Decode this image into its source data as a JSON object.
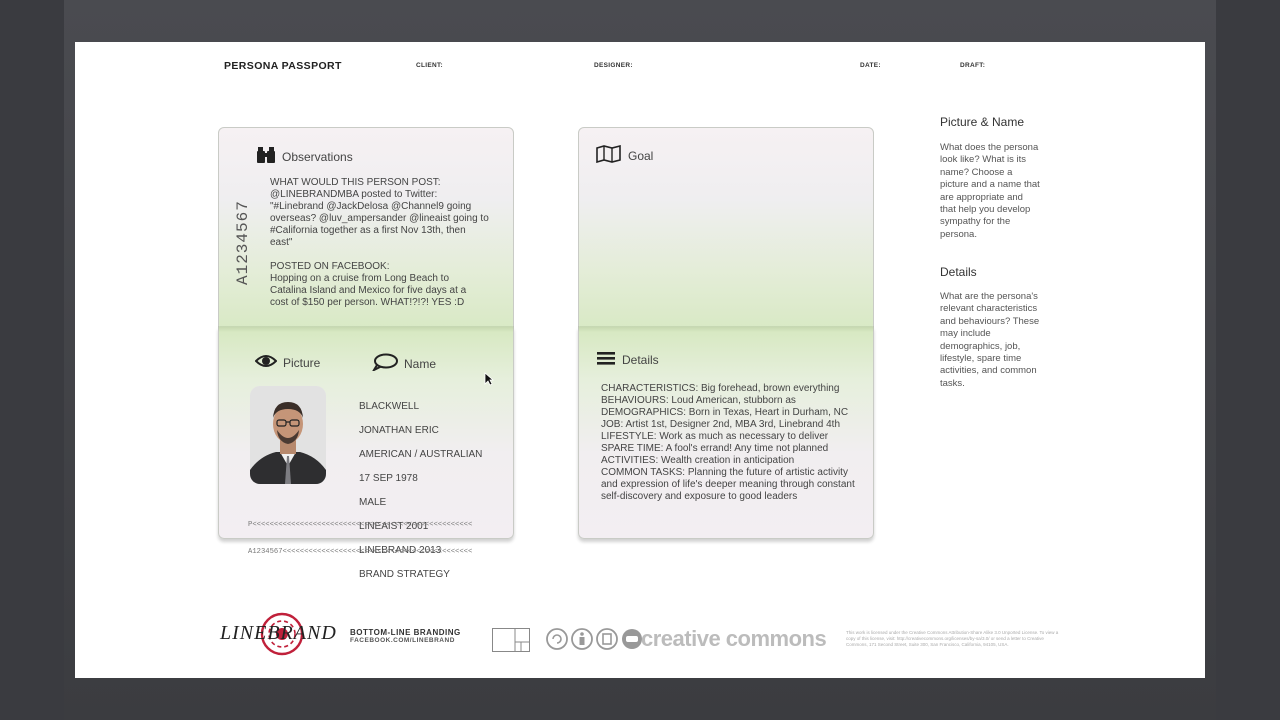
{
  "header": {
    "title": "PERSONA PASSPORT",
    "client_label": "CLIENT:",
    "designer_label": "DESIGNER:",
    "date_label": "DATE:",
    "draft_label": "DRAFT:"
  },
  "left_book": {
    "passport_number": "A1234567",
    "observations": {
      "heading": "Observations",
      "text": "WHAT WOULD THIS PERSON POST:\n@LINEBRANDMBA posted to Twitter:\n\"#Linebrand @JackDelosa @Channel9 going\noverseas? @luv_ampersander @lineaist going to\n#California together as a first Nov 13th, then\neast\"\n\nPOSTED ON FACEBOOK:\nHopping on a cruise from Long Beach to\nCatalina Island and Mexico for five days at a\ncost of $150 per person.  WHAT!?!?!  YES :D"
    },
    "picture_heading": "Picture",
    "name_heading": "Name",
    "name_lines": [
      "BLACKWELL",
      "JONATHAN ERIC",
      "AMERICAN / AUSTRALIAN",
      "17 SEP 1978",
      "MALE",
      "LINEAIST 2001",
      "LINEBRAND 2013",
      "BRAND STRATEGY"
    ],
    "mrz_line1": "P<<<<<<<<<<<<<<<<<<<<<<<<<<<<<<<<<<<<<<<<<<<<<<<<<<<",
    "mrz_line2": "A1234567<<<<<<<<<<<<<<<<<<<<<<<<<<<<<<<<<<<<<<<<<<<<"
  },
  "right_book": {
    "goal_heading": "Goal",
    "details_heading": "Details",
    "details_text": "CHARACTERISTICS:  Big forehead, brown everything\nBEHAVIOURS:  Loud American, stubborn as\nDEMOGRAPHICS: Born in Texas, Heart in Durham, NC\nJOB: Artist 1st, Designer 2nd, MBA 3rd, Linebrand 4th\nLIFESTYLE: Work as much as necessary to deliver\nSPARE TIME: A fool's errand!  Any time not planned\nACTIVITIES: Wealth creation in anticipation\nCOMMON TASKS: Planning the future of artistic activity\nand expression of life's deeper meaning through constant\nself-discovery and exposure to good leaders"
  },
  "sidebar": {
    "picture_name_heading": "Picture & Name",
    "picture_name_text": "What does the persona look like? What is its name? Choose a picture and a name that are appropriate and that help you develop sympathy for the persona.",
    "details_heading": "Details",
    "details_text": "What are the persona's relevant characteristics and behaviours? These may include demographics, job, lifestyle, spare time activities, and common tasks."
  },
  "footer": {
    "brand_logo": "LINEBRAND",
    "tagline": "BOTTOM-LINE BRANDING",
    "url": "FACEBOOK.COM/LINEBRAND",
    "cc_label": "creative commons",
    "legal_text": "This work is licensed under the Creative Commons Attribution-Share Alike 3.0 Unported License. To view a copy of this license, visit: http://creativecommons.org/licenses/by-sa/3.0/ or send a letter to Creative Commons, 171 Second Street, Suite 300, San Francisco, California, 94105, USA."
  },
  "colors": {
    "page_green": "#d8e9c4",
    "page_pink": "#f4eef2",
    "logo_red": "#c0203a"
  }
}
